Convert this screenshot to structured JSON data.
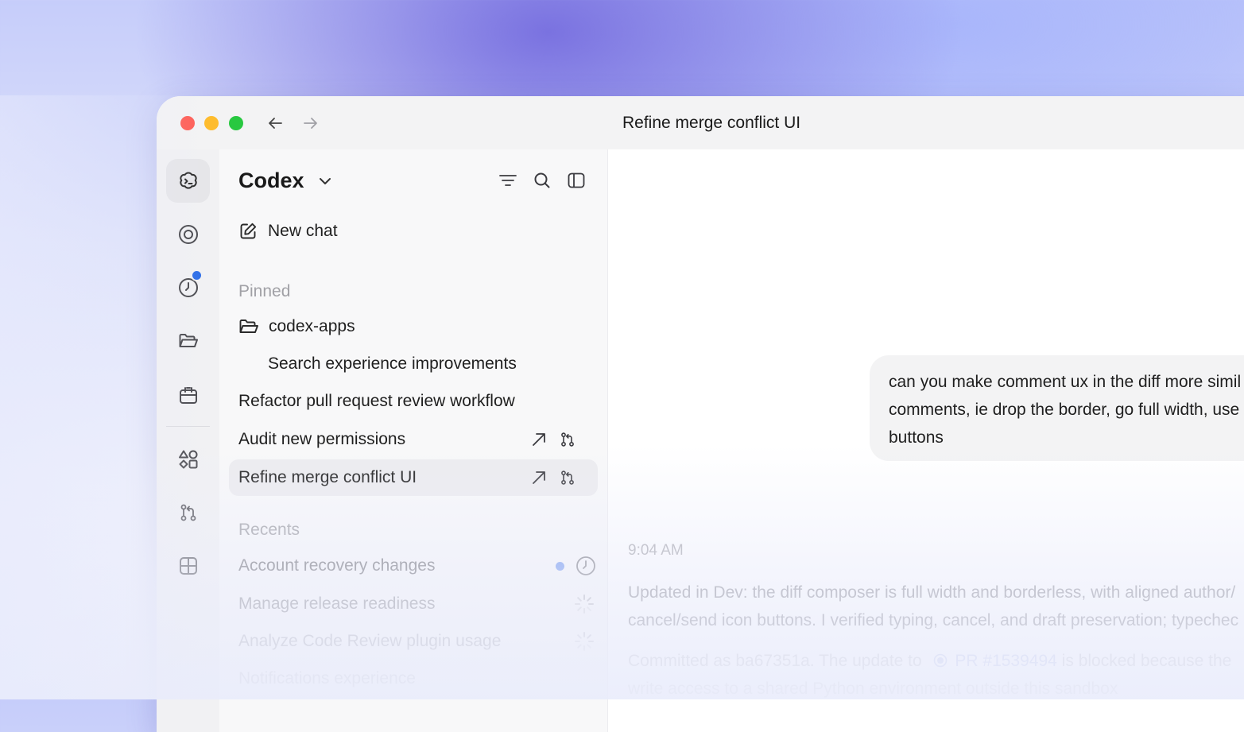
{
  "window": {
    "title": "Refine merge conflict UI"
  },
  "rail": {
    "items": [
      {
        "name": "codex-icon",
        "active": true
      },
      {
        "name": "target-icon"
      },
      {
        "name": "clock-icon",
        "badge": true
      },
      {
        "name": "folder-icon"
      },
      {
        "name": "calendar-icon"
      },
      {
        "name": "shapes-icon"
      },
      {
        "name": "pull-request-icon"
      },
      {
        "name": "grid-icon"
      }
    ]
  },
  "sidebar": {
    "title": "Codex",
    "new_chat": "New chat",
    "pinned_label": "Pinned",
    "pinned": {
      "project": "codex-apps",
      "project_child": "Search experience improvements",
      "items": [
        "Refactor pull request review workflow",
        "Audit new permissions",
        "Refine merge conflict UI"
      ]
    },
    "recents_label": "Recents",
    "recents": [
      "Account recovery changes",
      "Manage release readiness",
      "Analyze Code Review plugin usage",
      "Notifications experience"
    ]
  },
  "chat": {
    "user_message_lines": [
      "can you make comment ux in the diff more simil",
      "comments, ie drop the border, go full width, use",
      "buttons"
    ],
    "time": "9:04 AM",
    "assistant_lines": [
      "Updated in Dev: the diff composer is full width and borderless, with aligned author/",
      "cancel/send icon buttons. I verified typing, cancel, and draft preservation; typechec"
    ],
    "commit_prefix": "Committed as ba67351a. The update to",
    "commit_pr": "PR #1539494",
    "commit_suffix": "is blocked because the",
    "commit_line2": "write access to a shared Python environment outside this sandbox"
  },
  "colors": {
    "accent_dot": "#2f6fe8",
    "recent_dot": "#6f95ef"
  }
}
